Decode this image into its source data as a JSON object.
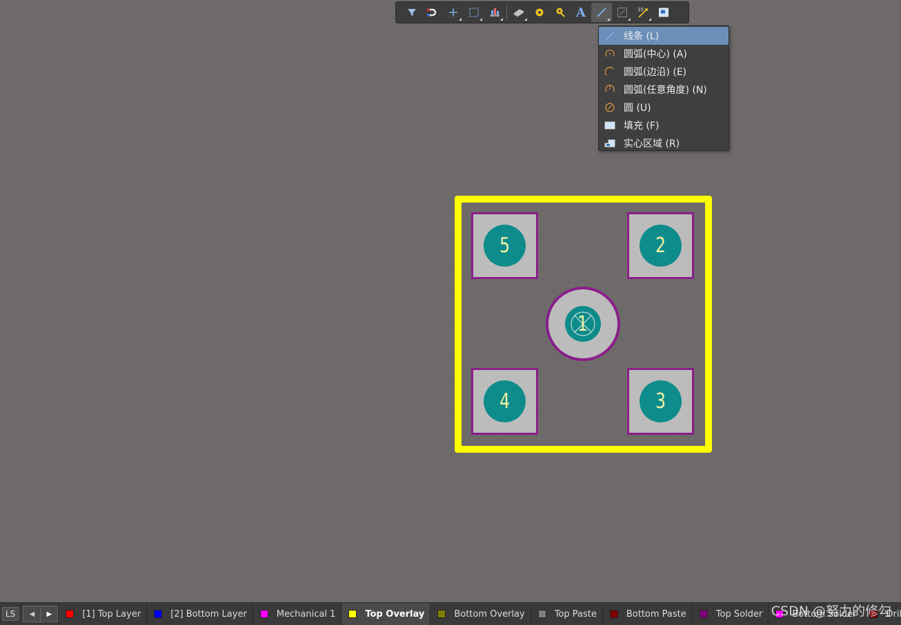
{
  "toolbar": {
    "buttons": [
      {
        "name": "filter",
        "has_menu": false
      },
      {
        "name": "snap-magnet",
        "has_menu": false
      },
      {
        "name": "cross-probe",
        "has_menu": true
      },
      {
        "name": "select-rect",
        "has_menu": true
      },
      {
        "name": "align",
        "has_menu": true
      },
      {
        "name": "component",
        "has_menu": true
      },
      {
        "name": "pad",
        "has_menu": false
      },
      {
        "name": "via",
        "has_menu": false
      },
      {
        "name": "string",
        "has_menu": false
      },
      {
        "name": "line",
        "has_menu": true,
        "active": true
      },
      {
        "name": "graph",
        "has_menu": true
      },
      {
        "name": "dimension",
        "has_menu": true
      },
      {
        "name": "region",
        "has_menu": false
      }
    ],
    "text_glyph": "A",
    "dimension_glyph": "10"
  },
  "menu": {
    "items": [
      {
        "label": "线条 (L)",
        "icon": "line-icon",
        "highlighted": true
      },
      {
        "label": "圆弧(中心) (A)",
        "icon": "arc-center-icon"
      },
      {
        "label": "圆弧(边沿) (E)",
        "icon": "arc-edge-icon"
      },
      {
        "label": "圆弧(任意角度) (N)",
        "icon": "arc-any-angle-icon"
      },
      {
        "label": "圆 (U)",
        "icon": "circle-icon"
      },
      {
        "label": "填充 (F)",
        "icon": "fill-icon"
      },
      {
        "label": "实心区域 (R)",
        "icon": "solid-region-icon"
      }
    ]
  },
  "footprint": {
    "outline_color": "#ffff00",
    "pads": [
      {
        "number": "5",
        "shape": "square"
      },
      {
        "number": "2",
        "shape": "square"
      },
      {
        "number": "1",
        "shape": "round"
      },
      {
        "number": "4",
        "shape": "square"
      },
      {
        "number": "3",
        "shape": "square"
      }
    ]
  },
  "layerbar": {
    "current_color": "#ffff00",
    "ls_label": "LS",
    "tabs": [
      {
        "label": "[1] Top Layer",
        "color": "#ff0000"
      },
      {
        "label": "[2] Bottom Layer",
        "color": "#0000ff"
      },
      {
        "label": "Mechanical 1",
        "color": "#ff00ff"
      },
      {
        "label": "Top Overlay",
        "color": "#ffff00",
        "active": true
      },
      {
        "label": "Bottom Overlay",
        "color": "#808000"
      },
      {
        "label": "Top Paste",
        "color": "#808080"
      },
      {
        "label": "Bottom Paste",
        "color": "#800000"
      },
      {
        "label": "Top Solder",
        "color": "#800080"
      },
      {
        "label": "Bottom Solder",
        "color": "#ff00ff"
      },
      {
        "label": "Drill Guide",
        "color": "#800000"
      }
    ]
  },
  "watermark": "CSDN @努力的修勾"
}
